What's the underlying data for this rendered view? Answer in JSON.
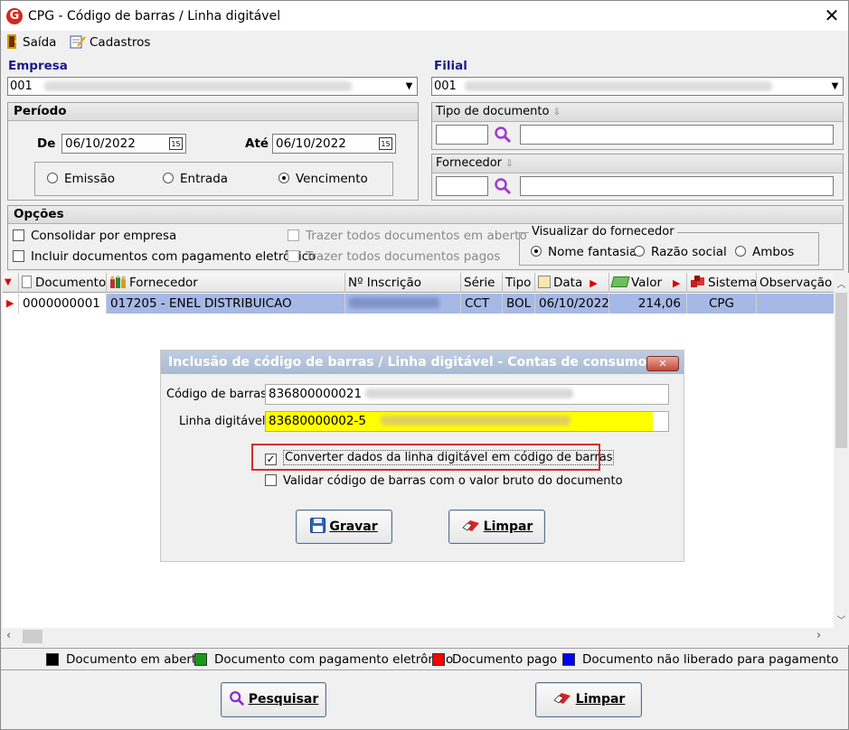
{
  "window": {
    "title": "CPG - Código de barras / Linha digitável",
    "close": "✕"
  },
  "menu": {
    "exit": "Saída",
    "register": "Cadastros"
  },
  "company": {
    "label": "Empresa",
    "value": "001"
  },
  "branch": {
    "label": "Filial",
    "value": "001"
  },
  "period": {
    "label": "Período",
    "from_label": "De",
    "from_value": "06/10/2022",
    "to_label": "Até",
    "to_value": "06/10/2022",
    "calendar_icon": "15",
    "options": [
      "Emissão",
      "Entrada",
      "Vencimento"
    ],
    "selected": "Vencimento"
  },
  "doc_type": {
    "label": "Tipo de documento"
  },
  "supplier": {
    "label": "Fornecedor"
  },
  "options": {
    "label": "Opções",
    "consolidate": "Consolidar por empresa",
    "include_electronic": "Incluir documentos com pagamento eletrônico",
    "bring_open": "Trazer todos documentos em aberto",
    "bring_paid": "Trazer todos documentos pagos",
    "view_supplier": {
      "label": "Visualizar do fornecedor",
      "choices": [
        "Nome fantasia",
        "Razão social",
        "Ambos"
      ],
      "selected": "Nome fantasia"
    }
  },
  "grid": {
    "columns": [
      "Documento",
      "Fornecedor",
      "Nº Inscrição",
      "Série",
      "Tipo",
      "Data",
      "Valor",
      "Sistema",
      "Observação"
    ],
    "rows": [
      {
        "documento": "0000000001",
        "fornecedor": "017205 - ENEL DISTRIBUICAO",
        "inscricao": "",
        "serie": "CCT",
        "tipo": "BOL",
        "data": "06/10/2022",
        "valor": "214,06",
        "sistema": "CPG",
        "observacao": ""
      }
    ]
  },
  "dialog": {
    "title": "Inclusão de código de barras / Linha digitável - Contas de consumo",
    "close": "✕",
    "barcode_label": "Código de barras",
    "barcode_value": "836800000021",
    "digitable_label": "Linha digitável",
    "digitable_value": "83680000002-5",
    "convert_label": "Converter dados da linha digitável em código de barras",
    "validate_label": "Validar código de barras com o valor bruto do documento",
    "save_button": "Gravar",
    "clear_button": "Limpar"
  },
  "legend": {
    "open": "Documento em aberto",
    "electronic": "Documento com pagamento eletrônico",
    "paid": "Documento pago",
    "not_released": "Documento não liberado para pagamento"
  },
  "footer": {
    "search_button": "Pesquisar",
    "clear_button": "Limpar"
  },
  "colors": {
    "row_selected": "#a6b8e6",
    "highlight": "#ffff00",
    "focus_box": "#d32f2f",
    "legend_black": "#000000",
    "legend_green": "#1a9a1a",
    "legend_red": "#ff0000",
    "legend_blue": "#0000ff"
  }
}
